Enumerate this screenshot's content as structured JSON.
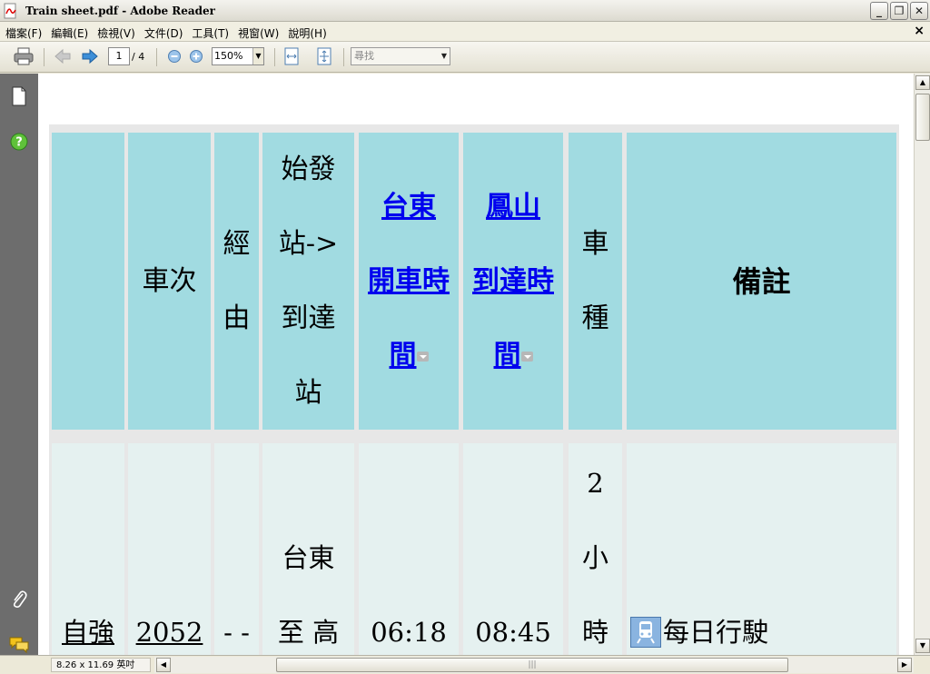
{
  "window": {
    "title": "Train sheet.pdf - Adobe Reader",
    "minimize": "_",
    "restore": "❐",
    "close": "✕"
  },
  "menubar": {
    "items": [
      "檔案(F)",
      "編輯(E)",
      "檢視(V)",
      "文件(D)",
      "工具(T)",
      "視窗(W)",
      "說明(H)"
    ],
    "close_doc": "×"
  },
  "toolbar": {
    "page_current": "1",
    "page_total": "/ 4",
    "zoom": "150%",
    "find_placeholder": "尋找"
  },
  "status": {
    "page_size": "8.26 x 11.69 英吋"
  },
  "table": {
    "headers": {
      "col1": "",
      "col2": "車次",
      "col3_lines": [
        "經",
        "由"
      ],
      "col4_lines": [
        "始發",
        "站->",
        "到達",
        "站"
      ],
      "col5_lines": [
        "台東",
        "開車時",
        "間"
      ],
      "col6_lines": [
        "鳳山",
        "到達時",
        "間"
      ],
      "col7_lines": [
        "車",
        "種"
      ],
      "col8": "備註"
    },
    "row1": {
      "train_type": "自強",
      "train_no": "2052",
      "via": "- -",
      "route_line1": "台東",
      "route_line2": "至 高",
      "depart": "06:18",
      "arrive": "08:45",
      "duration_lines": [
        "2",
        "小",
        "時"
      ],
      "note": "每日行駛"
    }
  },
  "colors": {
    "header_bg": "#a1dbe1",
    "row_bg": "#e5f1f0",
    "link": "#0000ee"
  }
}
